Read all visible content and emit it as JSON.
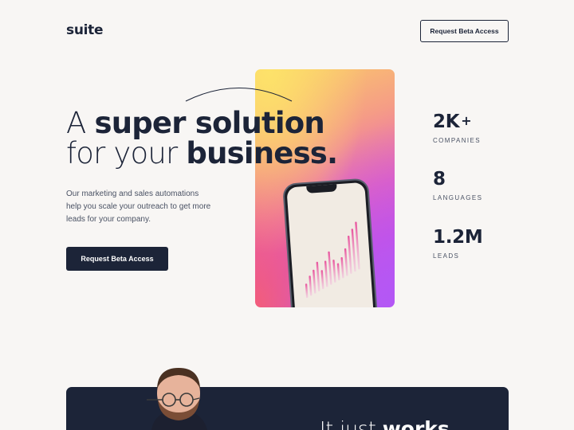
{
  "header": {
    "logo": "suite",
    "cta_label": "Request Beta Access"
  },
  "hero": {
    "headline_line1_light": "A ",
    "headline_line1_bold": "super solution",
    "headline_line2_light": "for your ",
    "headline_line2_bold": "business.",
    "lead": "Our marketing and sales automations help you scale your outreach to get more leads for your company.",
    "cta_label": "Request Beta Access"
  },
  "stats": [
    {
      "value": "2K",
      "suffix": "+",
      "label": "COMPANIES"
    },
    {
      "value": "8",
      "label": "LANGUAGES"
    },
    {
      "value": "1.2M",
      "label": "LEADS"
    }
  ],
  "bottom": {
    "headline_light": "It just ",
    "headline_bold": "works"
  },
  "colors": {
    "navy": "#1c2438",
    "background": "#f8f6f4",
    "gradient_top": "#fbd067",
    "gradient_bottom": "#b25cf2",
    "bar_pink": "#e86aa8"
  },
  "icons": [
    "decorative-arc",
    "phone-mockup",
    "bar-chart-graphic"
  ]
}
